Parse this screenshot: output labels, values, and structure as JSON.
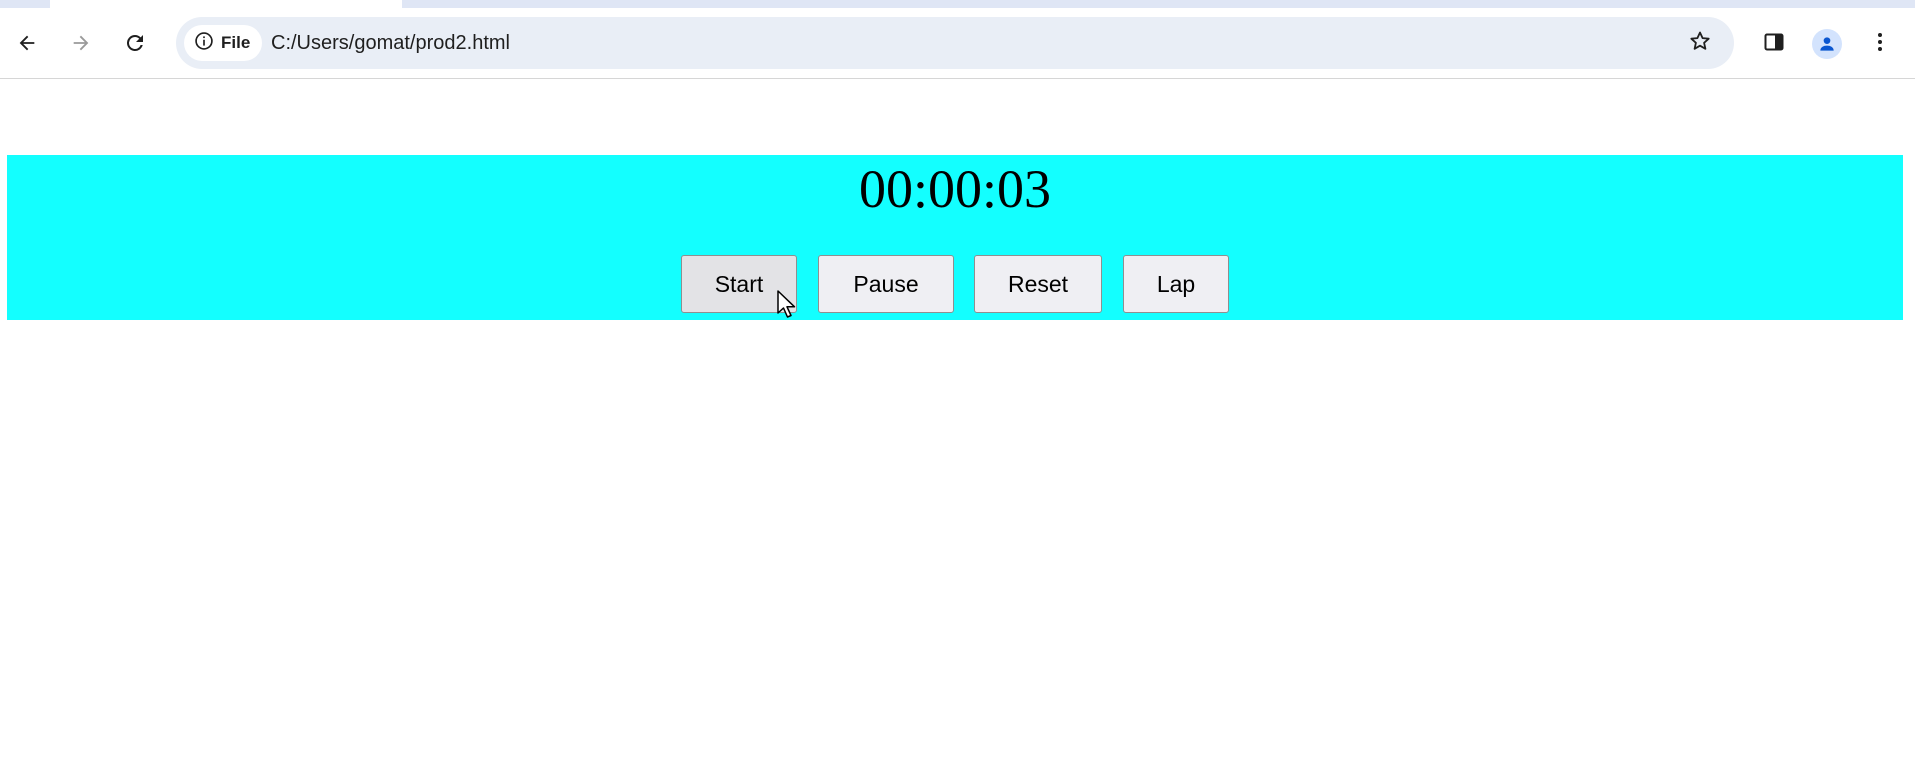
{
  "browser": {
    "address_chip_label": "File",
    "url": "C:/Users/gomat/prod2.html"
  },
  "stopwatch": {
    "time_display": "00:00:03",
    "buttons": {
      "start": "Start",
      "pause": "Pause",
      "reset": "Reset",
      "lap": "Lap"
    }
  },
  "colors": {
    "panel_background": "#13ffff",
    "button_background": "#efeff3",
    "button_hover_background": "#e3e3e6"
  },
  "icons": {
    "back": "arrow-left-icon",
    "forward": "arrow-right-icon",
    "reload": "reload-icon",
    "site_info": "info-icon",
    "bookmark": "star-icon",
    "side_panel": "side-panel-icon",
    "profile": "profile-avatar-icon",
    "menu": "kebab-menu-icon"
  }
}
